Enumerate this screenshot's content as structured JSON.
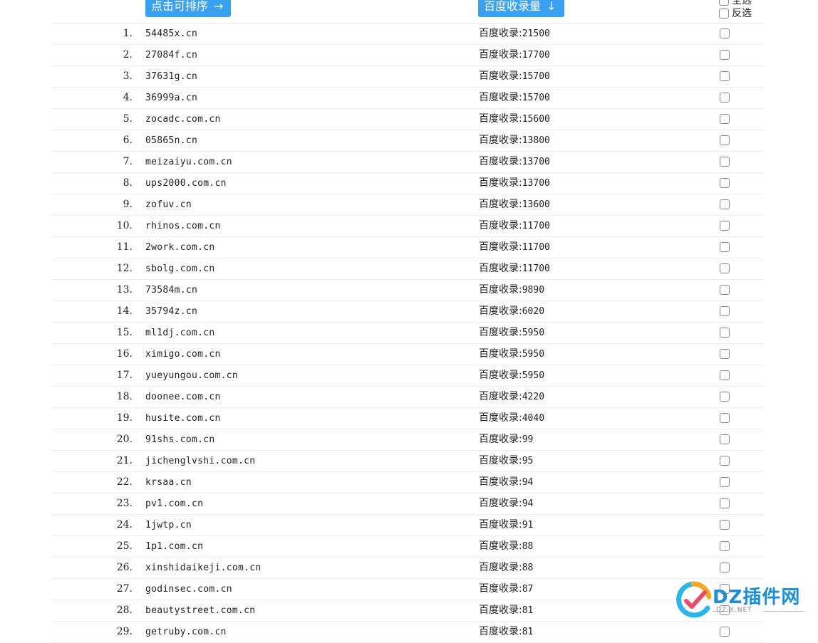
{
  "header": {
    "sort_name_label": "点击可排序",
    "sort_name_arrow": "→",
    "sort_count_label": "百度收录量",
    "sort_count_arrow": "↓",
    "select_all": "全选",
    "invert": "反选"
  },
  "count_prefix": "百度收录:",
  "rows": [
    {
      "n": "1.",
      "domain": "54485x.cn",
      "count": "21500"
    },
    {
      "n": "2.",
      "domain": "27084f.cn",
      "count": "17700"
    },
    {
      "n": "3.",
      "domain": "37631g.cn",
      "count": "15700"
    },
    {
      "n": "4.",
      "domain": "36999a.cn",
      "count": "15700"
    },
    {
      "n": "5.",
      "domain": "zocadc.com.cn",
      "count": "15600"
    },
    {
      "n": "6.",
      "domain": "05865n.cn",
      "count": "13800"
    },
    {
      "n": "7.",
      "domain": "meizaiyu.com.cn",
      "count": "13700"
    },
    {
      "n": "8.",
      "domain": "ups2000.com.cn",
      "count": "13700"
    },
    {
      "n": "9.",
      "domain": "zofuv.cn",
      "count": "13600"
    },
    {
      "n": "10.",
      "domain": "rhinos.com.cn",
      "count": "11700"
    },
    {
      "n": "11.",
      "domain": "2work.com.cn",
      "count": "11700"
    },
    {
      "n": "12.",
      "domain": "sbolg.com.cn",
      "count": "11700"
    },
    {
      "n": "13.",
      "domain": "73584m.cn",
      "count": "9890"
    },
    {
      "n": "14.",
      "domain": "35794z.cn",
      "count": "6020"
    },
    {
      "n": "15.",
      "domain": "ml1dj.com.cn",
      "count": "5950"
    },
    {
      "n": "16.",
      "domain": "ximigo.com.cn",
      "count": "5950"
    },
    {
      "n": "17.",
      "domain": "yueyungou.com.cn",
      "count": "5950"
    },
    {
      "n": "18.",
      "domain": "doonee.com.cn",
      "count": "4220"
    },
    {
      "n": "19.",
      "domain": "husite.com.cn",
      "count": "4040"
    },
    {
      "n": "20.",
      "domain": "91shs.com.cn",
      "count": "99"
    },
    {
      "n": "21.",
      "domain": "jichenglvshi.com.cn",
      "count": "95"
    },
    {
      "n": "22.",
      "domain": "krsaa.cn",
      "count": "94"
    },
    {
      "n": "23.",
      "domain": "pv1.com.cn",
      "count": "94"
    },
    {
      "n": "24.",
      "domain": "1jwtp.cn",
      "count": "91"
    },
    {
      "n": "25.",
      "domain": "1p1.com.cn",
      "count": "88"
    },
    {
      "n": "26.",
      "domain": "xinshidaikeji.com.cn",
      "count": "88"
    },
    {
      "n": "27.",
      "domain": "godinsec.com.cn",
      "count": "87"
    },
    {
      "n": "28.",
      "domain": "beautystreet.com.cn",
      "count": "81"
    },
    {
      "n": "29.",
      "domain": "getruby.com.cn",
      "count": "81"
    }
  ],
  "watermark": {
    "text": "DZ插件网",
    "sub": "DZ-X.NET",
    "colors": [
      "#2cb5e8",
      "#f5a623",
      "#e94b6a",
      "#7ac943"
    ]
  }
}
